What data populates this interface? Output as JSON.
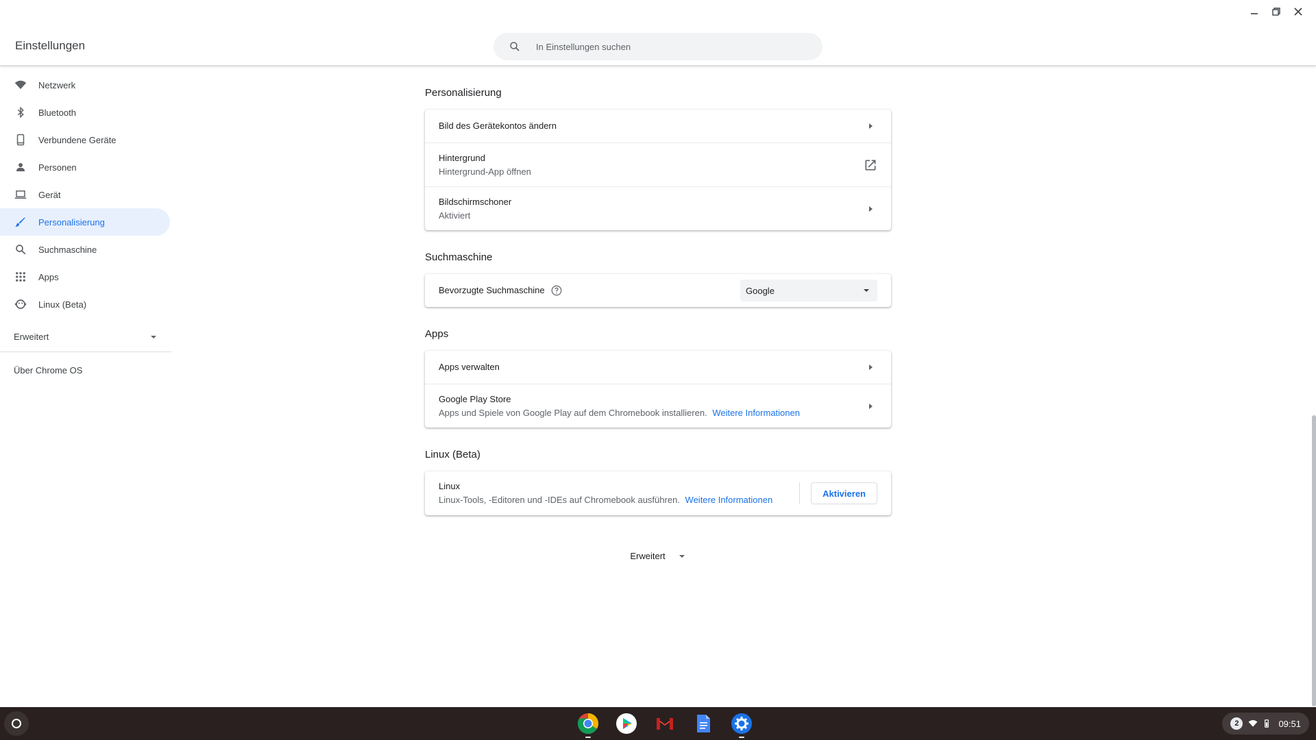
{
  "window": {
    "controls": [
      "minimize",
      "restore",
      "close"
    ]
  },
  "header": {
    "title": "Einstellungen",
    "search_placeholder": "In Einstellungen suchen"
  },
  "sidebar": {
    "items": [
      {
        "label": "Netzwerk",
        "icon": "wifi-icon"
      },
      {
        "label": "Bluetooth",
        "icon": "bluetooth-icon"
      },
      {
        "label": "Verbundene Geräte",
        "icon": "phone-icon"
      },
      {
        "label": "Personen",
        "icon": "person-icon"
      },
      {
        "label": "Gerät",
        "icon": "laptop-icon"
      },
      {
        "label": "Personalisierung",
        "icon": "brush-icon",
        "active": true
      },
      {
        "label": "Suchmaschine",
        "icon": "search-icon"
      },
      {
        "label": "Apps",
        "icon": "apps-grid-icon"
      },
      {
        "label": "Linux (Beta)",
        "icon": "penguin-icon"
      }
    ],
    "advanced_label": "Erweitert",
    "about_label": "Über Chrome OS"
  },
  "main": {
    "personalization": {
      "title": "Personalisierung",
      "rows": [
        {
          "primary": "Bild des Gerätekontos ändern"
        },
        {
          "primary": "Hintergrund",
          "secondary": "Hintergrund-App öffnen"
        },
        {
          "primary": "Bildschirmschoner",
          "secondary": "Aktiviert"
        }
      ]
    },
    "search_engine": {
      "title": "Suchmaschine",
      "label": "Bevorzugte Suchmaschine",
      "selected": "Google"
    },
    "apps": {
      "title": "Apps",
      "rows": [
        {
          "primary": "Apps verwalten"
        },
        {
          "primary": "Google Play Store",
          "secondary": "Apps und Spiele von Google Play auf dem Chromebook installieren.",
          "link": "Weitere Informationen"
        }
      ]
    },
    "linux": {
      "title": "Linux (Beta)",
      "primary": "Linux",
      "secondary": "Linux-Tools, -Editoren und -IDEs auf Chromebook ausführen.",
      "link": "Weitere Informationen",
      "button": "Aktivieren"
    },
    "advanced_label": "Erweitert"
  },
  "shelf": {
    "apps": [
      "chrome-icon",
      "play-store-icon",
      "gmail-icon",
      "docs-icon",
      "settings-icon"
    ],
    "notification_count": "2",
    "time": "09:51"
  },
  "colors": {
    "accent": "#1a73e8",
    "active_bg": "#e8f0fe",
    "shelf_bg": "#2a2020"
  }
}
